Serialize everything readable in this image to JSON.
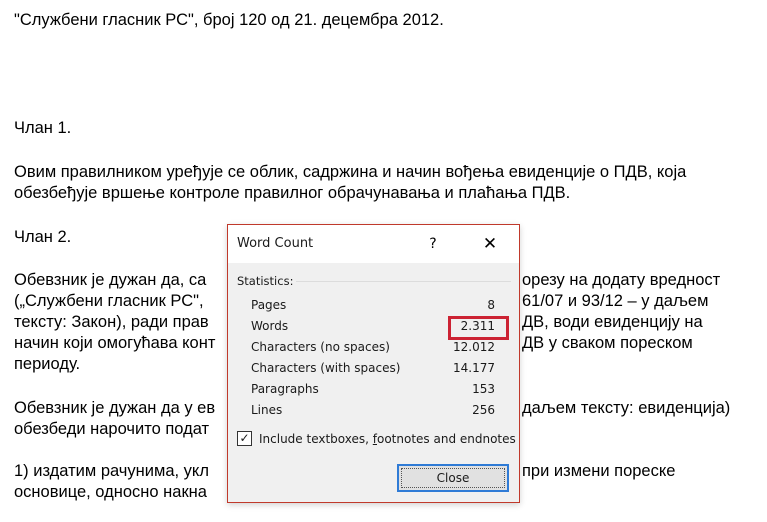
{
  "document": {
    "header": "\"Службени гласник РС\", број 120 од 21. децембра 2012.",
    "lines": [
      "Члан 1.",
      "Овим правилником уређује се облик, садржина и начин вођења евиденције о ПДВ, која",
      "обезбеђује вршење контроле правилног обрачунавања и плаћања ПДВ.",
      "Члан 2.",
      "Обевзник је дужан да, са",
      "(„Службени гласник РС\",",
      "тексту: Закон), ради прав",
      "начин који омогућава конт",
      "периоду.",
      "Обевзник је дужан да у ев",
      "обезбеди нарочито подат",
      "1) издатим рачунима, укл",
      "основице, односно накна"
    ],
    "right_fragments": [
      "орезу на додату вредност",
      "61/07 и 93/12 – у даљем",
      "ДВ, води евиденцију на",
      "ДВ у сваком пореском",
      "даљем тексту: евиденција)",
      "при измени пореске"
    ]
  },
  "dialog": {
    "title": "Word Count",
    "help": "?",
    "close_x": "✕",
    "statistics_label": "Statistics:",
    "rows": [
      {
        "label": "Pages",
        "value": "8"
      },
      {
        "label": "Words",
        "value": "2.311"
      },
      {
        "label": "Characters (no spaces)",
        "value": "12.012"
      },
      {
        "label": "Characters (with spaces)",
        "value": "14.177"
      },
      {
        "label": "Paragraphs",
        "value": "153"
      },
      {
        "label": "Lines",
        "value": "256"
      }
    ],
    "checkbox": {
      "checked": true,
      "label_prefix": "Include textboxes, ",
      "label_underlined": "f",
      "label_suffix": "ootnotes and endnotes"
    },
    "close_button": "Close"
  }
}
